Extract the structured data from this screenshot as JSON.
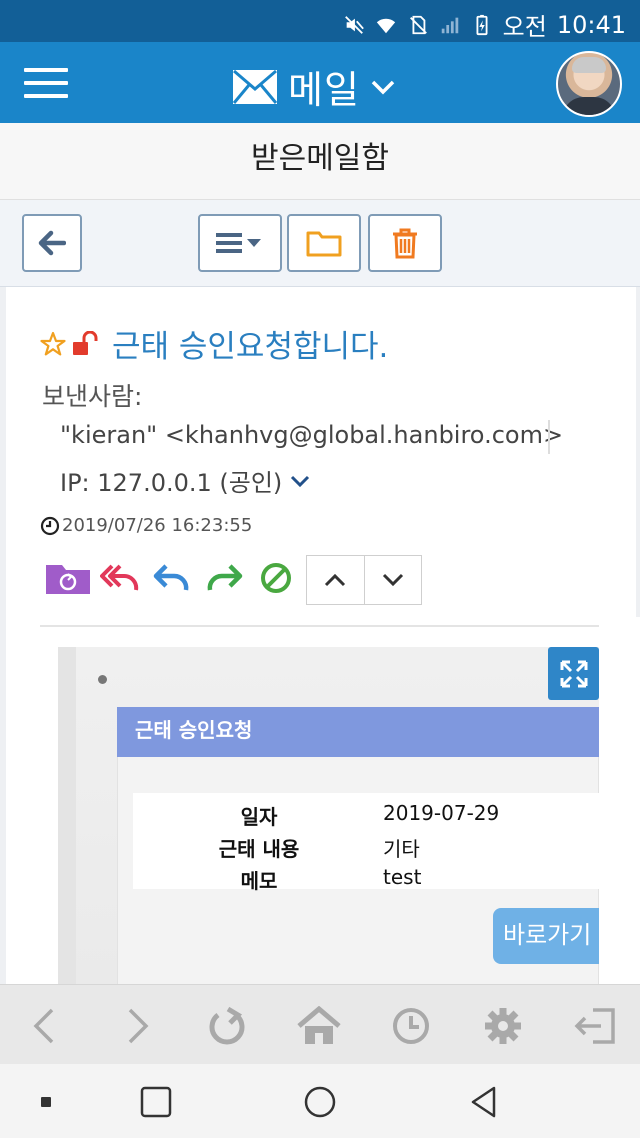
{
  "status_bar": {
    "ampm": "오전",
    "time": "10:41"
  },
  "header": {
    "title": "메일",
    "icons": [
      "menu-icon",
      "mail-icon",
      "chevron-down-icon",
      "avatar"
    ]
  },
  "page": {
    "title": "받은메일함"
  },
  "toolbar": {
    "icons": [
      "back-arrow-icon",
      "list-menu-icon",
      "folder-icon",
      "trash-icon"
    ]
  },
  "mail": {
    "subject": "근태 승인요청합니다.",
    "sender_label": "보낸사람:",
    "sender_address": "\"kieran\" <khanhvg@global.hanbiro.com>",
    "sender_ip": "IP: 127.0.0.1 (공인)",
    "datetime": "2019/07/26 16:23:55",
    "action_icons": [
      "move-folder-icon",
      "reply-all-icon",
      "reply-icon",
      "forward-icon",
      "block-icon",
      "up-icon",
      "down-icon"
    ]
  },
  "body": {
    "card_title": "근태 승인요청",
    "rows": [
      {
        "key": "일자",
        "value": "2019-07-29"
      },
      {
        "key": "근태 내용",
        "value": "기타"
      },
      {
        "key": "메모",
        "value": "test"
      }
    ],
    "button": "바로가기"
  },
  "browser_nav": {
    "icons": [
      "back-icon",
      "forward-icon",
      "refresh-icon",
      "home-icon",
      "history-icon",
      "settings-icon",
      "logout-icon"
    ]
  },
  "system_nav": {
    "icons": [
      "recents-dot-icon",
      "square-icon",
      "circle-home-icon",
      "triangle-back-icon"
    ]
  },
  "colors": {
    "status": "#125f97",
    "appbar": "#1a85c9",
    "subject": "#2a7fc0",
    "card": "#7f98de",
    "accent_orange": "#f0a020"
  }
}
